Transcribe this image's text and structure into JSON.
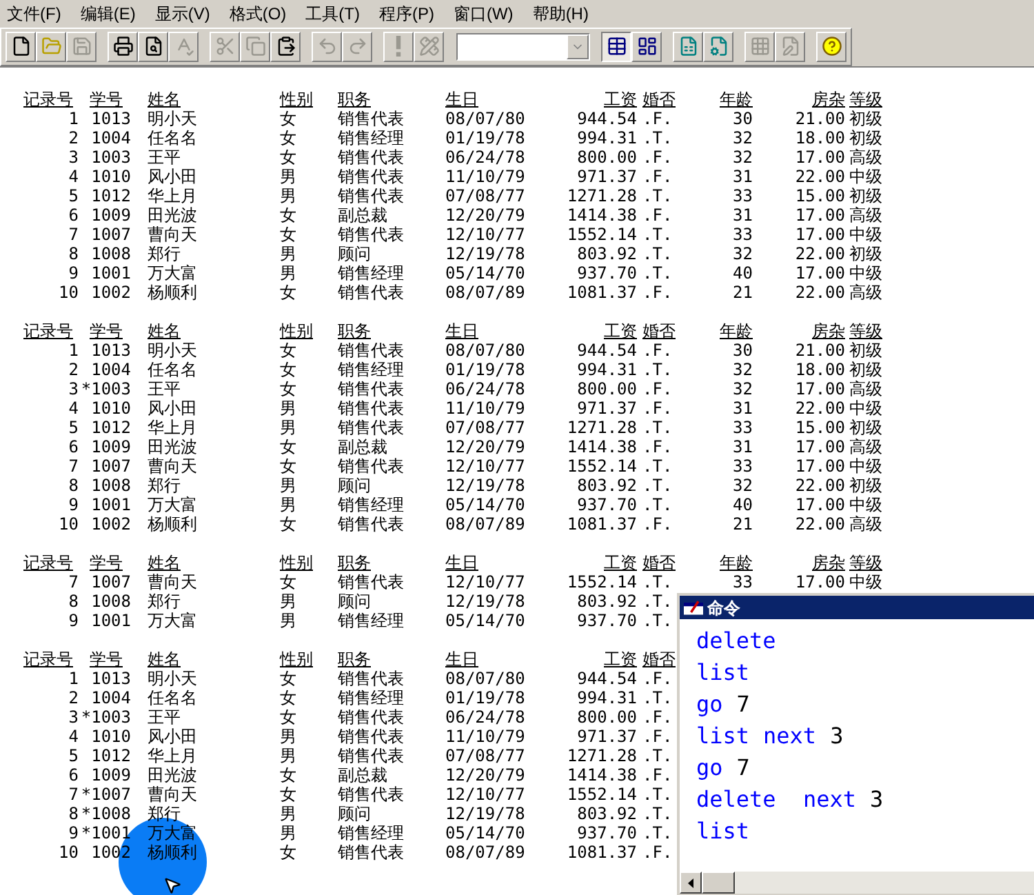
{
  "menu": [
    "文件(F)",
    "编辑(E)",
    "显示(V)",
    "格式(O)",
    "工具(T)",
    "程序(P)",
    "窗口(W)",
    "帮助(H)"
  ],
  "toolbar": {
    "buttons": [
      {
        "disabled": false,
        "pressed": false
      },
      {
        "disabled": false,
        "pressed": false
      },
      {
        "disabled": true,
        "pressed": false
      },
      {
        "disabled": false,
        "pressed": false
      },
      {
        "disabled": false,
        "pressed": false
      },
      {
        "disabled": true,
        "pressed": false
      },
      {
        "disabled": true,
        "pressed": false
      },
      {
        "disabled": true,
        "pressed": false
      },
      {
        "disabled": false,
        "pressed": false
      },
      {
        "disabled": true,
        "pressed": false
      },
      {
        "disabled": true,
        "pressed": false
      },
      {
        "disabled": true,
        "pressed": false
      },
      {
        "disabled": true,
        "pressed": false
      },
      {
        "disabled": false,
        "pressed": true
      },
      {
        "disabled": false,
        "pressed": false
      },
      {
        "disabled": false,
        "pressed": false
      },
      {
        "disabled": false,
        "pressed": false
      },
      {
        "disabled": true,
        "pressed": false
      },
      {
        "disabled": true,
        "pressed": false
      },
      {
        "disabled": false,
        "pressed": false
      }
    ]
  },
  "tables": [
    {
      "columns": [
        "记录号",
        "学号",
        "姓名",
        "性别",
        "职务",
        "生日",
        "工资",
        "婚否",
        "年龄",
        "房杂",
        "等级"
      ],
      "rows": [
        [
          "1",
          "1013",
          "明小天",
          "女",
          "销售代表",
          "08/07/80",
          "944.54",
          ".F.",
          "30",
          "21.00",
          "初级"
        ],
        [
          "2",
          "1004",
          "任名名",
          "女",
          "销售经理",
          "01/19/78",
          "994.31",
          ".T.",
          "32",
          "18.00",
          "初级"
        ],
        [
          "3",
          "1003",
          "王平",
          "女",
          "销售代表",
          "06/24/78",
          "800.00",
          ".F.",
          "32",
          "17.00",
          "高级"
        ],
        [
          "4",
          "1010",
          "风小田",
          "男",
          "销售代表",
          "11/10/79",
          "971.37",
          ".F.",
          "31",
          "22.00",
          "中级"
        ],
        [
          "5",
          "1012",
          "华上月",
          "男",
          "销售代表",
          "07/08/77",
          "1271.28",
          ".T.",
          "33",
          "15.00",
          "初级"
        ],
        [
          "6",
          "1009",
          "田光波",
          "女",
          "副总裁",
          "12/20/79",
          "1414.38",
          ".F.",
          "31",
          "17.00",
          "高级"
        ],
        [
          "7",
          "1007",
          "曹向天",
          "女",
          "销售代表",
          "12/10/77",
          "1552.14",
          ".T.",
          "33",
          "17.00",
          "中级"
        ],
        [
          "8",
          "1008",
          "郑行",
          "男",
          "顾问",
          "12/19/78",
          "803.92",
          ".T.",
          "32",
          "22.00",
          "初级"
        ],
        [
          "9",
          "1001",
          "万大富",
          "男",
          "销售经理",
          "05/14/70",
          "937.70",
          ".T.",
          "40",
          "17.00",
          "中级"
        ],
        [
          "10",
          "1002",
          "杨顺利",
          "女",
          "销售代表",
          "08/07/89",
          "1081.37",
          ".F.",
          "21",
          "22.00",
          "高级"
        ]
      ]
    },
    {
      "columns": [
        "记录号",
        "学号",
        "姓名",
        "性别",
        "职务",
        "生日",
        "工资",
        "婚否",
        "年龄",
        "房杂",
        "等级"
      ],
      "rows": [
        [
          "1",
          "1013",
          "明小天",
          "女",
          "销售代表",
          "08/07/80",
          "944.54",
          ".F.",
          "30",
          "21.00",
          "初级"
        ],
        [
          "2",
          "1004",
          "任名名",
          "女",
          "销售经理",
          "01/19/78",
          "994.31",
          ".T.",
          "32",
          "18.00",
          "初级"
        ],
        [
          "3",
          "*1003",
          "王平",
          "女",
          "销售代表",
          "06/24/78",
          "800.00",
          ".F.",
          "32",
          "17.00",
          "高级"
        ],
        [
          "4",
          "1010",
          "风小田",
          "男",
          "销售代表",
          "11/10/79",
          "971.37",
          ".F.",
          "31",
          "22.00",
          "中级"
        ],
        [
          "5",
          "1012",
          "华上月",
          "男",
          "销售代表",
          "07/08/77",
          "1271.28",
          ".T.",
          "33",
          "15.00",
          "初级"
        ],
        [
          "6",
          "1009",
          "田光波",
          "女",
          "副总裁",
          "12/20/79",
          "1414.38",
          ".F.",
          "31",
          "17.00",
          "高级"
        ],
        [
          "7",
          "1007",
          "曹向天",
          "女",
          "销售代表",
          "12/10/77",
          "1552.14",
          ".T.",
          "33",
          "17.00",
          "中级"
        ],
        [
          "8",
          "1008",
          "郑行",
          "男",
          "顾问",
          "12/19/78",
          "803.92",
          ".T.",
          "32",
          "22.00",
          "初级"
        ],
        [
          "9",
          "1001",
          "万大富",
          "男",
          "销售经理",
          "05/14/70",
          "937.70",
          ".T.",
          "40",
          "17.00",
          "中级"
        ],
        [
          "10",
          "1002",
          "杨顺利",
          "女",
          "销售代表",
          "08/07/89",
          "1081.37",
          ".F.",
          "21",
          "22.00",
          "高级"
        ]
      ]
    },
    {
      "columns": [
        "记录号",
        "学号",
        "姓名",
        "性别",
        "职务",
        "生日",
        "工资",
        "婚否",
        "年龄",
        "房杂",
        "等级"
      ],
      "rows": [
        [
          "7",
          "1007",
          "曹向天",
          "女",
          "销售代表",
          "12/10/77",
          "1552.14",
          ".T.",
          "33",
          "17.00",
          "中级"
        ],
        [
          "8",
          "1008",
          "郑行",
          "男",
          "顾问",
          "12/19/78",
          "803.92",
          ".T."
        ],
        [
          "9",
          "1001",
          "万大富",
          "男",
          "销售经理",
          "05/14/70",
          "937.70",
          ".T."
        ]
      ]
    },
    {
      "columns": [
        "记录号",
        "学号",
        "姓名",
        "性别",
        "职务",
        "生日",
        "工资",
        "婚否"
      ],
      "rows": [
        [
          "1",
          "1013",
          "明小天",
          "女",
          "销售代表",
          "08/07/80",
          "944.54",
          ".F."
        ],
        [
          "2",
          "1004",
          "任名名",
          "女",
          "销售经理",
          "01/19/78",
          "994.31",
          ".T."
        ],
        [
          "3",
          "*1003",
          "王平",
          "女",
          "销售代表",
          "06/24/78",
          "800.00",
          ".F."
        ],
        [
          "4",
          "1010",
          "风小田",
          "男",
          "销售代表",
          "11/10/79",
          "971.37",
          ".F."
        ],
        [
          "5",
          "1012",
          "华上月",
          "男",
          "销售代表",
          "07/08/77",
          "1271.28",
          ".T."
        ],
        [
          "6",
          "1009",
          "田光波",
          "女",
          "副总裁",
          "12/20/79",
          "1414.38",
          ".F."
        ],
        [
          "7",
          "*1007",
          "曹向天",
          "女",
          "销售代表",
          "12/10/77",
          "1552.14",
          ".T."
        ],
        [
          "8",
          "*1008",
          "郑行",
          "男",
          "顾问",
          "12/19/78",
          "803.92",
          ".T."
        ],
        [
          "9",
          "*1001",
          "万大富",
          "男",
          "销售经理",
          "05/14/70",
          "937.70",
          ".T."
        ],
        [
          "10",
          "1002",
          "杨顺利",
          "女",
          "销售代表",
          "08/07/89",
          "1081.37",
          ".F."
        ]
      ]
    }
  ],
  "command_window": {
    "title": "命令",
    "lines": [
      [
        {
          "text": "delete",
          "kind": "keyword"
        }
      ],
      [
        {
          "text": "list",
          "kind": "keyword"
        }
      ],
      [
        {
          "text": "go",
          "kind": "keyword"
        },
        {
          "text": "7",
          "kind": "number"
        }
      ],
      [
        {
          "text": "list",
          "kind": "keyword"
        },
        {
          "text": "next",
          "kind": "keyword"
        },
        {
          "text": "3",
          "kind": "number"
        }
      ],
      [
        {
          "text": "go",
          "kind": "keyword"
        },
        {
          "text": "7",
          "kind": "number"
        }
      ],
      [
        {
          "text": "delete ",
          "kind": "keyword"
        },
        {
          "text": "next",
          "kind": "keyword"
        },
        {
          "text": "3",
          "kind": "number"
        }
      ],
      [
        {
          "text": "list",
          "kind": "keyword"
        }
      ]
    ]
  }
}
